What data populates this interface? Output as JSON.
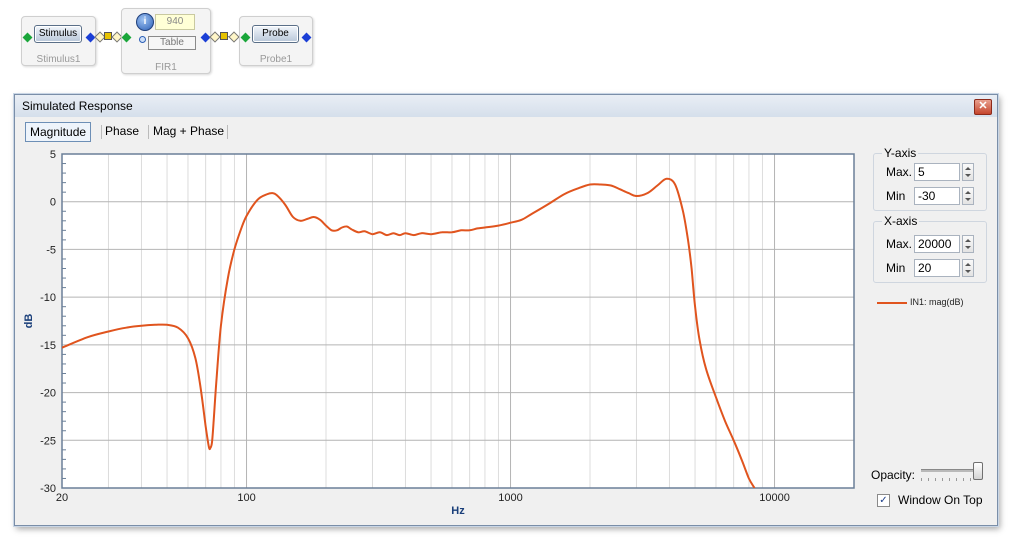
{
  "flow": {
    "stimulus": {
      "button": "Stimulus",
      "caption": "Stimulus1"
    },
    "fir": {
      "value": "940",
      "table_button": "Table",
      "caption": "FIR1"
    },
    "probe": {
      "button": "Probe",
      "caption": "Probe1"
    }
  },
  "window": {
    "title": "Simulated Response",
    "close_label": "✕",
    "tabs": [
      "Magnitude",
      "Phase",
      "Mag + Phase"
    ],
    "active_tab": 0
  },
  "y_axis_group": {
    "title": "Y-axis",
    "max_label": "Max.",
    "max_value": "5",
    "min_label": "Min",
    "min_value": "-30"
  },
  "x_axis_group": {
    "title": "X-axis",
    "max_label": "Max.",
    "max_value": "20000",
    "min_label": "Min",
    "min_value": "20"
  },
  "legend": {
    "label": "IN1: mag(dB)"
  },
  "opacity": {
    "label": "Opacity:",
    "value": 1.0
  },
  "window_on_top": {
    "label": "Window On Top",
    "checked": true
  },
  "colors": {
    "series": "#e0541e",
    "grid_major": "#b4b4b4",
    "grid_minor": "#dcdcdc",
    "plot_bg": "#ffffff"
  },
  "icons": {
    "fir_info": "info-icon",
    "close": "close-icon"
  },
  "chart_data": {
    "type": "line",
    "xlabel": "Hz",
    "ylabel": "dB",
    "xscale": "log",
    "xlim": [
      20,
      20000
    ],
    "ylim": [
      -30,
      5
    ],
    "x_ticks": [
      20,
      100,
      1000,
      10000
    ],
    "x_tick_labels": [
      "20",
      "100",
      "1000",
      "10000"
    ],
    "y_ticks": [
      5,
      0,
      -5,
      -10,
      -15,
      -20,
      -25,
      -30
    ],
    "y_tick_labels": [
      "5",
      "0",
      "-5",
      "-10",
      "-15",
      "-20",
      "-25",
      "-30"
    ],
    "grid": true,
    "legend_position": "right",
    "series": [
      {
        "name": "IN1: mag(dB)",
        "x": [
          20,
          25,
          30,
          35,
          40,
          45,
          50,
          55,
          60,
          64,
          67,
          70,
          72,
          73,
          74,
          75,
          77,
          80,
          85,
          90,
          95,
          100,
          110,
          120,
          125,
          130,
          140,
          150,
          160,
          170,
          180,
          190,
          200,
          210,
          220,
          230,
          240,
          250,
          265,
          280,
          300,
          320,
          340,
          360,
          380,
          400,
          430,
          460,
          500,
          550,
          600,
          650,
          700,
          750,
          800,
          900,
          1000,
          1100,
          1200,
          1400,
          1600,
          1800,
          2000,
          2200,
          2400,
          2600,
          2800,
          3000,
          3300,
          3600,
          3900,
          4200,
          4500,
          4700,
          4850,
          5000,
          5200,
          5500,
          6000,
          6500,
          7000,
          7500,
          8000,
          8400
        ],
        "y": [
          -15.3,
          -14.2,
          -13.6,
          -13.2,
          -13.0,
          -12.9,
          -12.9,
          -13.2,
          -14.3,
          -16.4,
          -19.5,
          -23.5,
          -25.7,
          -25.8,
          -25.2,
          -23.2,
          -18.5,
          -13.0,
          -8.0,
          -5.0,
          -3.0,
          -1.5,
          0.2,
          0.8,
          0.9,
          0.7,
          -0.3,
          -1.6,
          -2.0,
          -1.8,
          -1.6,
          -1.9,
          -2.5,
          -3.0,
          -3.0,
          -2.7,
          -2.6,
          -2.9,
          -3.2,
          -3.1,
          -3.4,
          -3.2,
          -3.5,
          -3.3,
          -3.5,
          -3.3,
          -3.5,
          -3.3,
          -3.4,
          -3.2,
          -3.2,
          -3.0,
          -3.0,
          -2.8,
          -2.7,
          -2.5,
          -2.2,
          -1.9,
          -1.3,
          -0.2,
          0.8,
          1.4,
          1.8,
          1.8,
          1.7,
          1.3,
          0.9,
          0.6,
          0.9,
          1.7,
          2.4,
          1.8,
          -1.0,
          -4.0,
          -7.0,
          -11.0,
          -14.5,
          -17.5,
          -20.5,
          -23.0,
          -25.0,
          -27.0,
          -29.0,
          -30.0
        ]
      }
    ]
  }
}
